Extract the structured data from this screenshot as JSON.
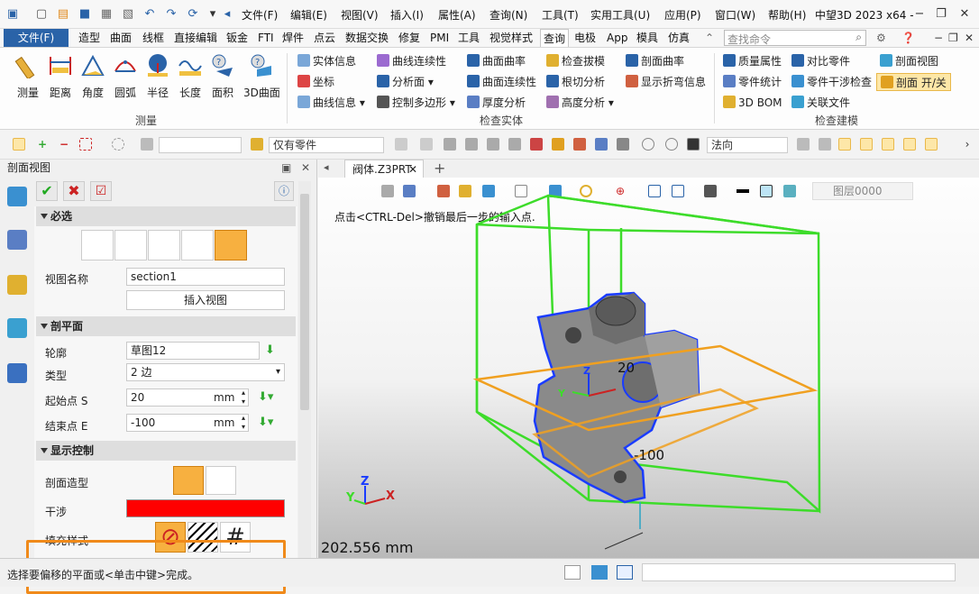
{
  "app": {
    "title": "阀体.Z3PRT - 中望3D 2023 x64 -",
    "title_short": "中望3D 2023 x64 -",
    "menu": [
      "文件(F)",
      "编辑(E)",
      "视图(V)",
      "插入(I)",
      "属性(A)",
      "查询(N)",
      "工具(T)",
      "实用工具(U)",
      "应用(P)",
      "窗口(W)",
      "帮助(H)"
    ]
  },
  "ribbon_tabs": {
    "file": "文件(F)",
    "items": [
      "造型",
      "曲面",
      "线框",
      "直接编辑",
      "钣金",
      "FTI",
      "焊件",
      "点云",
      "数据交换",
      "修复",
      "PMI",
      "工具",
      "视觉样式",
      "查询",
      "电极",
      "App",
      "模具",
      "仿真"
    ],
    "active": "查询",
    "search_placeholder": "查找命令"
  },
  "ribbon": {
    "measure_group": {
      "label": "测量",
      "buttons": [
        "测量",
        "距离",
        "角度",
        "圆弧",
        "半径",
        "长度",
        "面积",
        "3D曲面"
      ]
    },
    "inspect_group": {
      "label": "检查实体",
      "col1": [
        "实体信息",
        "坐标",
        "曲线信息"
      ],
      "col2": [
        "曲线连续性",
        "分析面",
        "控制多边形"
      ],
      "col3": [
        "曲面曲率",
        "曲面连续性",
        "厚度分析"
      ],
      "col4": [
        "检查拔模",
        "根切分析",
        "高度分析"
      ],
      "col5": [
        "剖面曲率",
        "显示折弯信息"
      ]
    },
    "model_group": {
      "label": "检查建模",
      "col1": [
        "质量属性",
        "零件统计",
        "3D BOM"
      ],
      "col2": [
        "对比零件",
        "零件干涉检查",
        "关联文件"
      ],
      "col3": [
        "剖面视图",
        "剖面 开/关"
      ]
    }
  },
  "toolbar2": {
    "filter_value": "仅有零件",
    "direction_value": "法向"
  },
  "panel": {
    "title": "剖面视图",
    "sections": {
      "required": "必选",
      "plane": "剖平面",
      "display": "显示控制"
    },
    "view_name_label": "视图名称",
    "view_name_value": "section1",
    "insert_view_button": "插入视图",
    "profile_label": "轮廓",
    "profile_value": "草图12",
    "type_label": "类型",
    "type_value": "2 边",
    "start_label": "起始点 S",
    "start_value": "20",
    "end_label": "结束点 E",
    "end_value": "-100",
    "unit": "mm",
    "section_shape_label": "剖面造型",
    "interference_label": "干涉",
    "interference_color": "#ff0000",
    "fill_style_label": "填充样式"
  },
  "viewport": {
    "tab_label": "阀体.Z3PRT",
    "prompt": "点击<CTRL-Del>撤销最后一步的输入点.",
    "layer": "图层0000",
    "label_start": "20",
    "label_end": "-100",
    "measure": "202.556 mm",
    "axes": {
      "x": "X",
      "y": "Y",
      "z": "Z"
    }
  },
  "status": {
    "text": "选择要偏移的平面或<单击中键>完成。"
  },
  "colors": {
    "accent": "#2a63a8",
    "highlight": "#f08a1a",
    "bbox": "#3ddc2a",
    "plane": "#f0a020",
    "section_edge": "#1a3cff"
  }
}
